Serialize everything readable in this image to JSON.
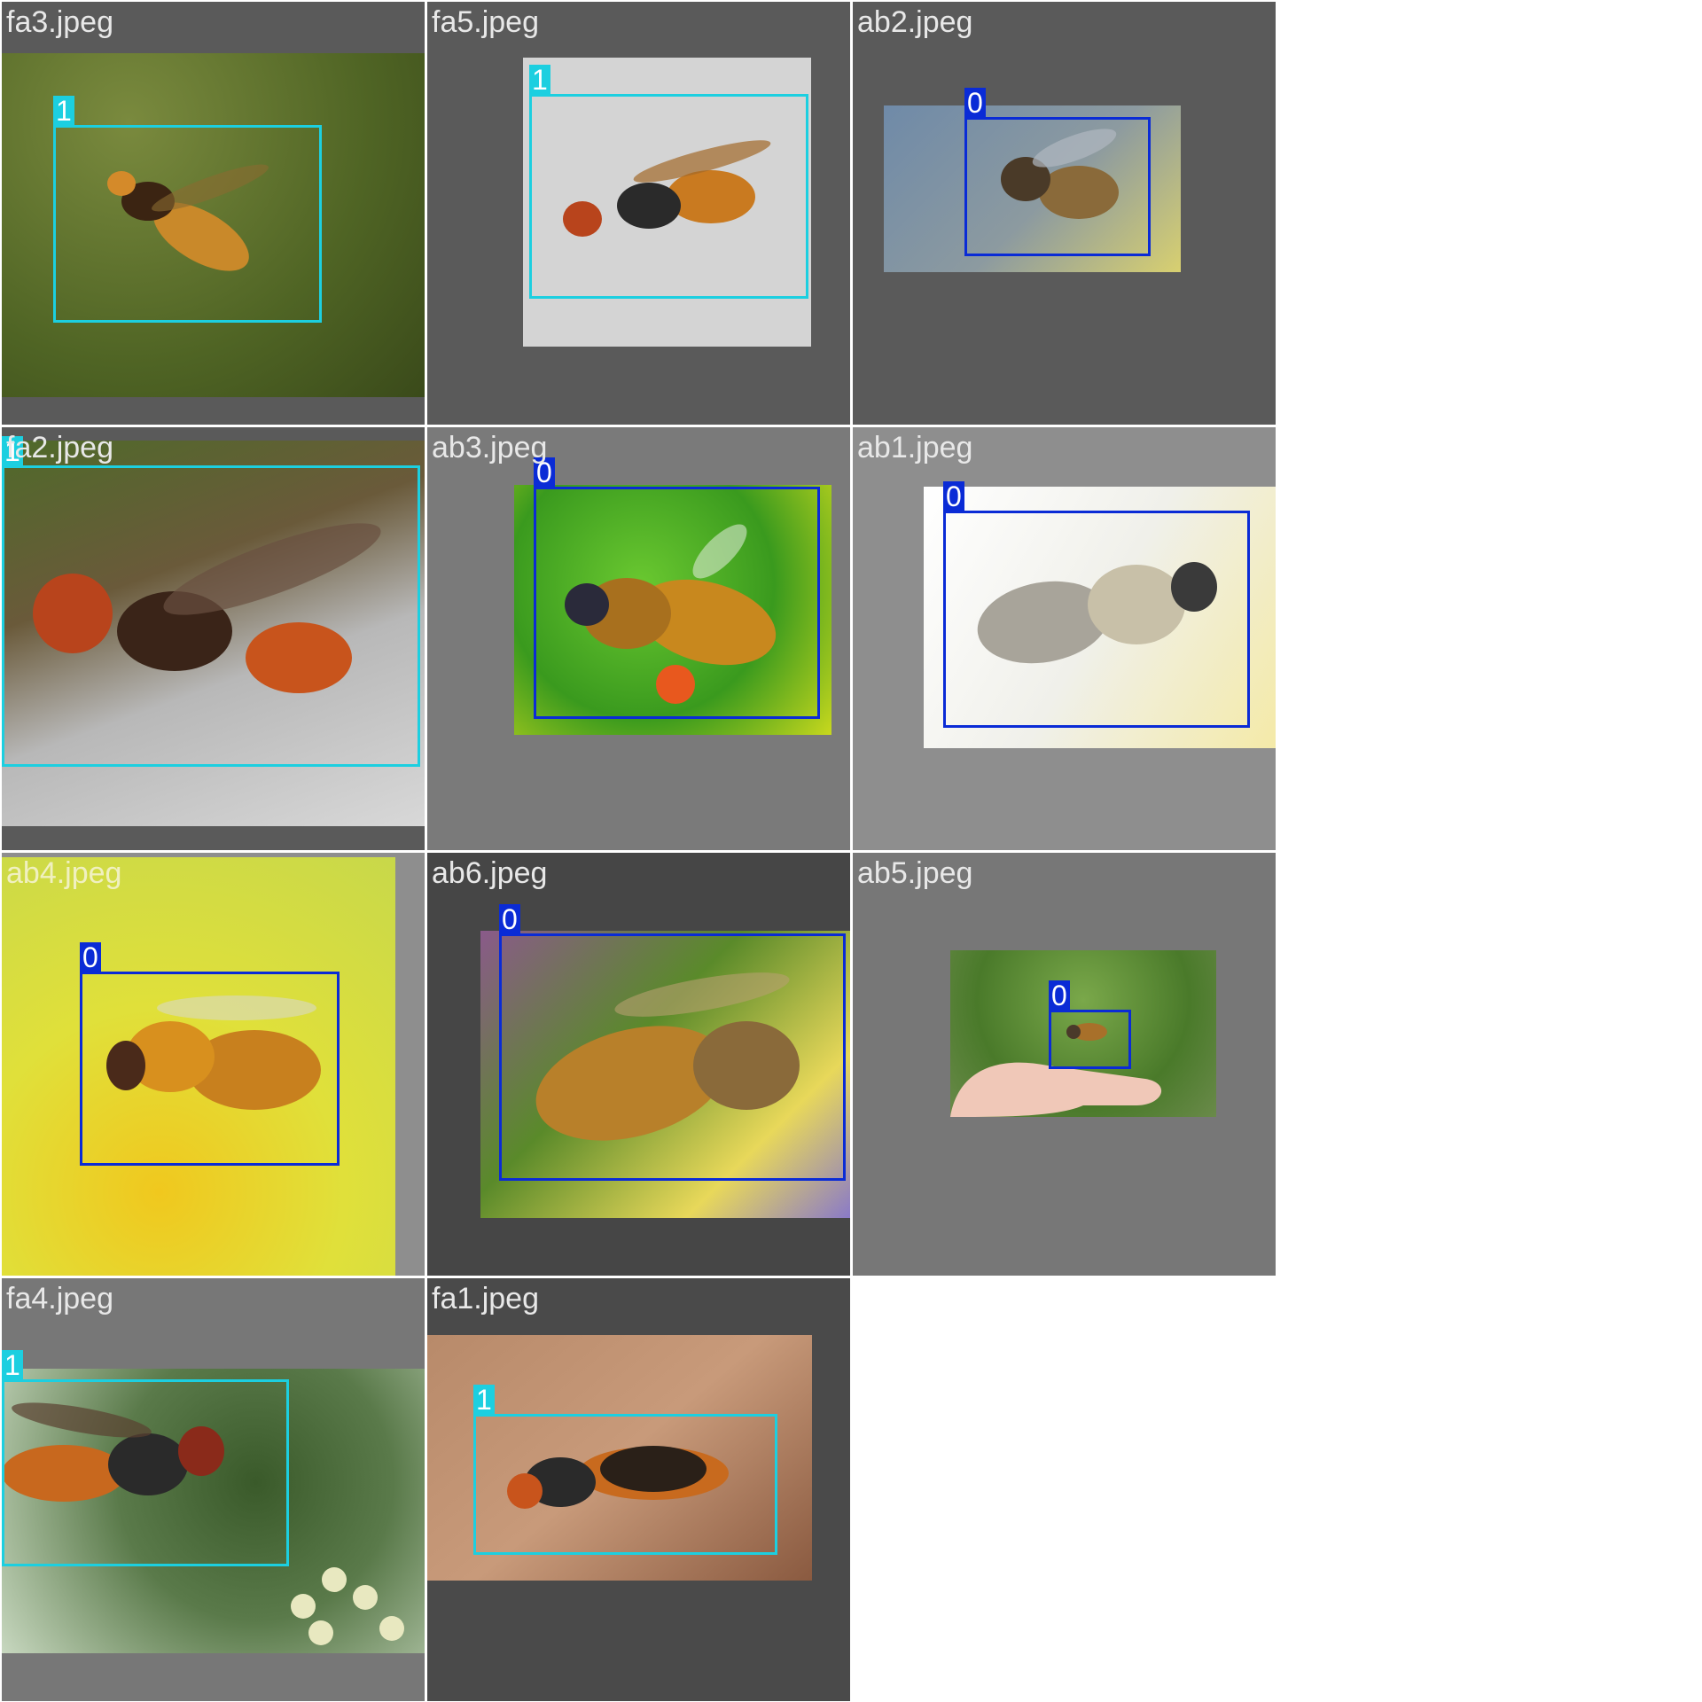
{
  "tiles": [
    {
      "filename": "fa3.jpeg",
      "label": "1"
    },
    {
      "filename": "fa5.jpeg",
      "label": "1"
    },
    {
      "filename": "ab2.jpeg",
      "label": "0"
    },
    {
      "filename": "fa2.jpeg",
      "label": "1"
    },
    {
      "filename": "ab3.jpeg",
      "label": "0"
    },
    {
      "filename": "ab1.jpeg",
      "label": "0"
    },
    {
      "filename": "ab4.jpeg",
      "label": "0"
    },
    {
      "filename": "ab6.jpeg",
      "label": "0"
    },
    {
      "filename": "ab5.jpeg",
      "label": "0"
    },
    {
      "filename": "fa4.jpeg",
      "label": "1"
    },
    {
      "filename": "fa1.jpeg",
      "label": "1"
    }
  ],
  "colors": {
    "class_0": "#0a2bd6",
    "class_1": "#1ccfe0",
    "tile_bg_dark": "#5a5a5a",
    "tile_bg_mid": "#7a7a7a",
    "tile_bg_light": "#8e8e8e"
  },
  "icons": {
    "hornet": "hornet-icon",
    "bee": "honeybee-icon"
  }
}
